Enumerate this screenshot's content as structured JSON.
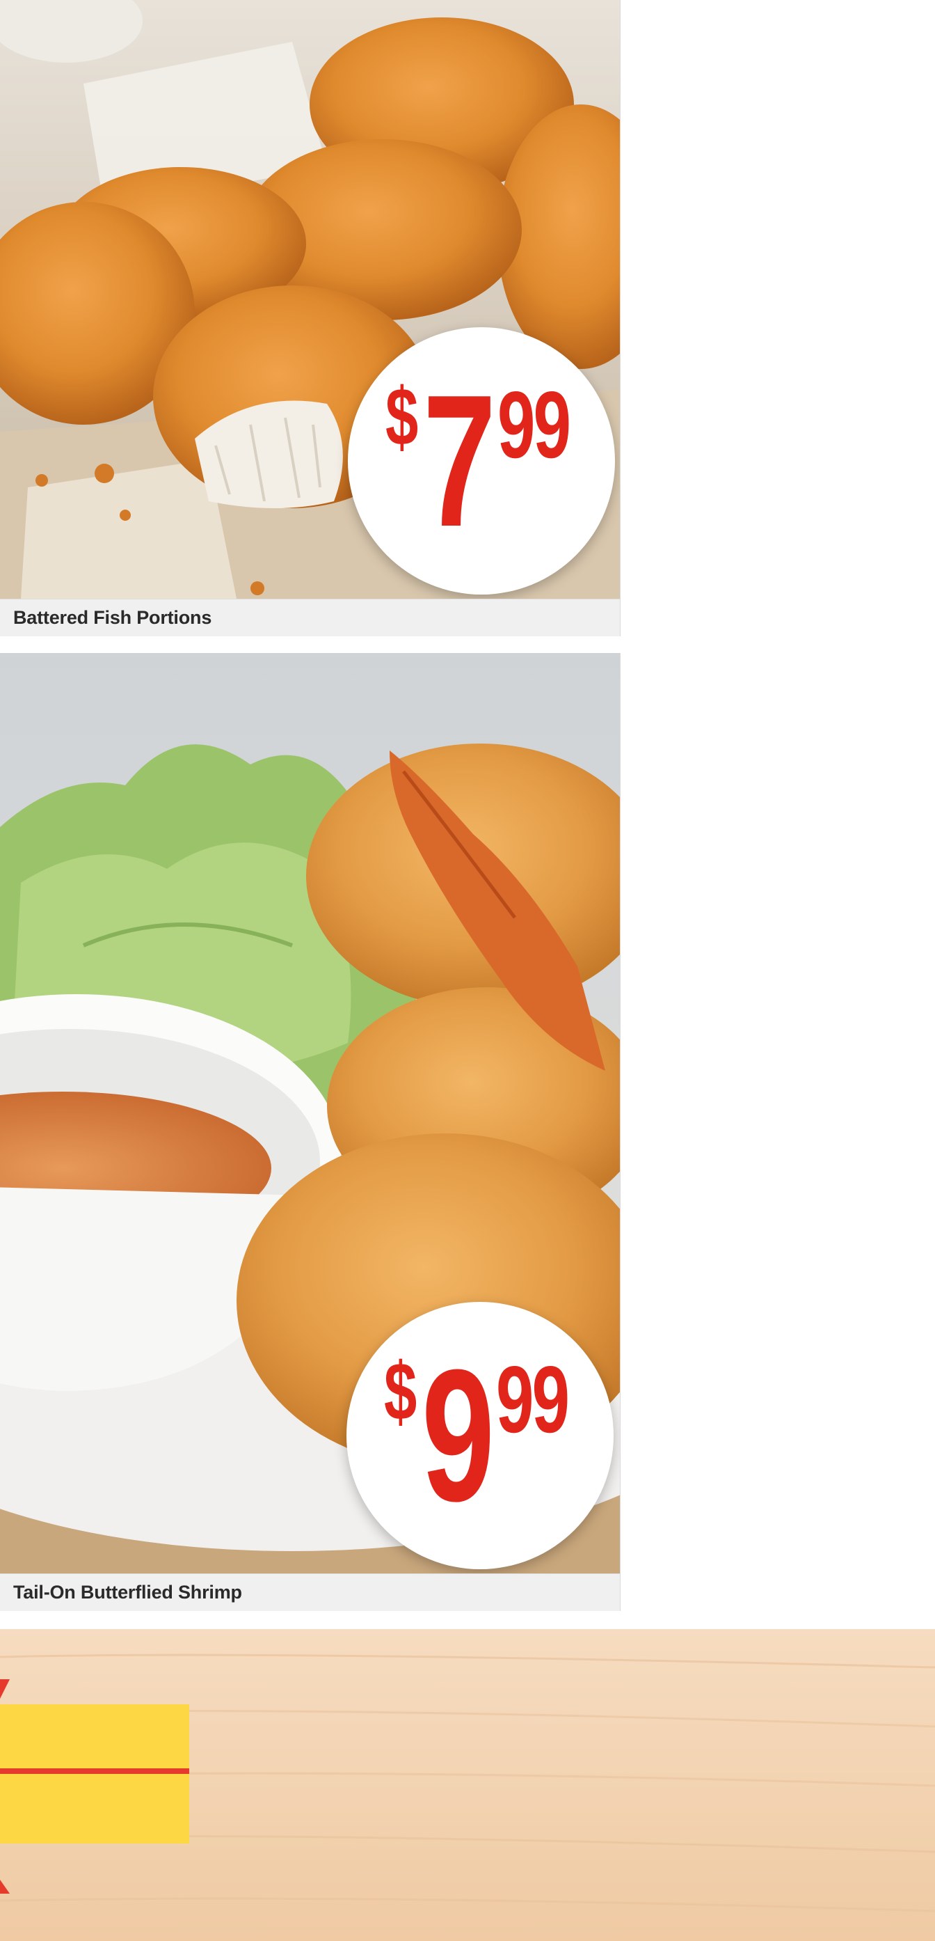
{
  "products": [
    {
      "name": "Battered Fish Portions",
      "price": {
        "currency": "$",
        "whole": "7",
        "cents": "99"
      },
      "image_icon": "battered-fish-portions-photo"
    },
    {
      "name": "Tail-On Butterflied Shrimp",
      "price": {
        "currency": "$",
        "whole": "9",
        "cents": "99"
      },
      "image_icon": "butterflied-shrimp-photo"
    }
  ],
  "colors": {
    "price_red": "#e1251b",
    "badge_white": "#ffffff",
    "caption_bg": "#f0f0f0",
    "banner_wood": "#f3d5b5",
    "banner_yellow": "#fdd844"
  }
}
